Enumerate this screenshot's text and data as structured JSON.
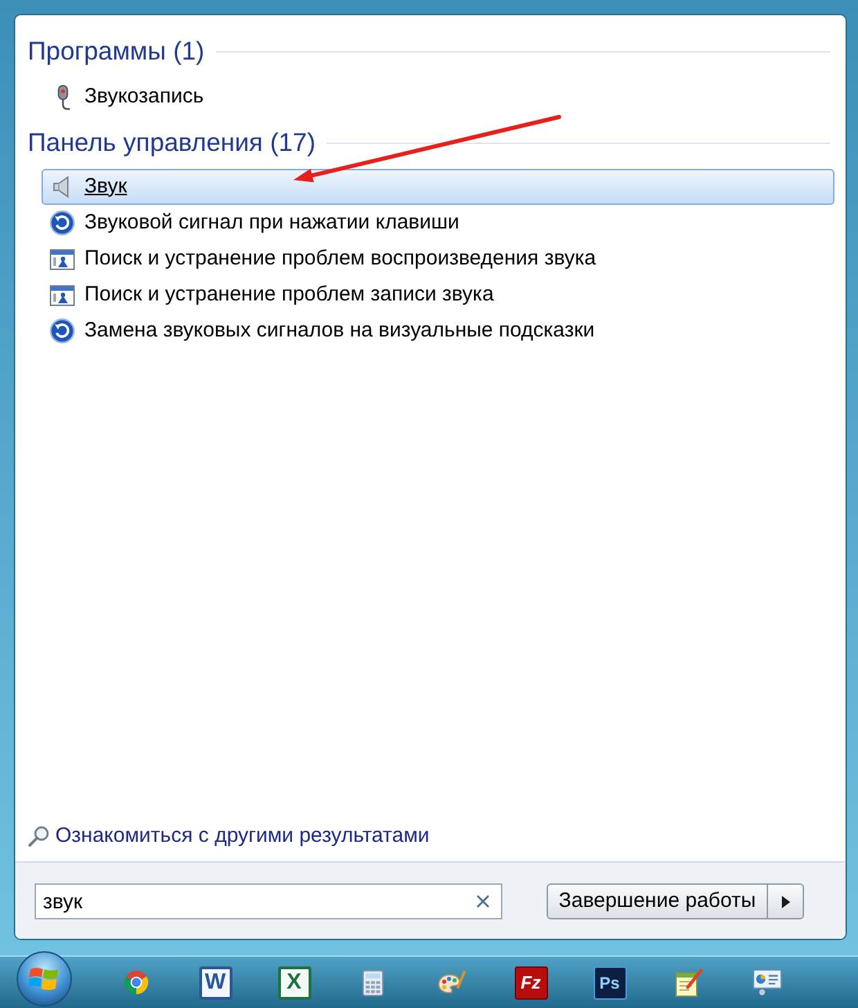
{
  "start_menu": {
    "groups": [
      {
        "heading": "Программы (1)",
        "items": [
          {
            "kind": "microphone",
            "label": "Звукозапись",
            "selected": false
          }
        ]
      },
      {
        "heading": "Панель управления (17)",
        "items": [
          {
            "kind": "speaker",
            "label": "Звук",
            "selected": true
          },
          {
            "kind": "ease_of_access",
            "label": "Звуковой сигнал при нажатии клавиши",
            "selected": false
          },
          {
            "kind": "troubleshooter",
            "label": "Поиск и устранение проблем воспроизведения звука",
            "selected": false
          },
          {
            "kind": "troubleshooter",
            "label": "Поиск и устранение проблем записи звука",
            "selected": false
          },
          {
            "kind": "ease_of_access",
            "label": "Замена звуковых сигналов на визуальные подсказки",
            "selected": false
          }
        ]
      }
    ],
    "more_results": "Ознакомиться с другими результатами",
    "search": {
      "value": "звук"
    },
    "shutdown": {
      "label": "Завершение работы"
    }
  },
  "taskbar": {
    "apps": [
      {
        "kind": "browser"
      },
      {
        "kind": "document",
        "label": "W"
      },
      {
        "kind": "spreadsheet",
        "label": "X"
      },
      {
        "kind": "calculator"
      },
      {
        "kind": "paint"
      },
      {
        "kind": "file_transfer",
        "label": "Fz"
      },
      {
        "kind": "image_editor",
        "label": "Ps"
      },
      {
        "kind": "notepad"
      },
      {
        "kind": "remote_desktop"
      }
    ]
  }
}
